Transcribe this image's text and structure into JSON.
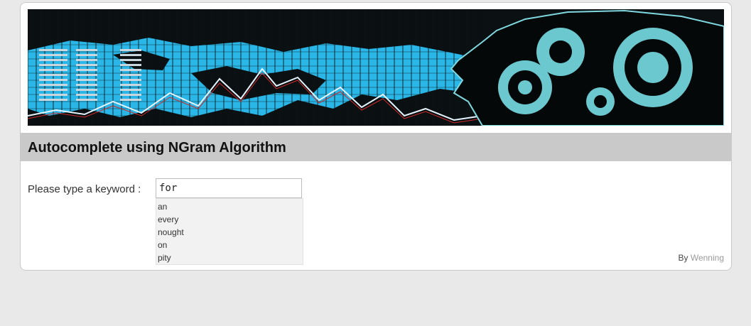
{
  "header": {
    "title": "Autocomplete using NGram Algorithm"
  },
  "banner": {
    "icon": "brain-gears-world-map-banner"
  },
  "form": {
    "label": "Please type a keyword :",
    "input_value": "for"
  },
  "suggestions": [
    "an",
    "every",
    "nought",
    "on",
    "pity"
  ],
  "footer": {
    "by_label": "By",
    "author": "Wenning"
  },
  "colors": {
    "page_bg": "#e9e9e9",
    "titlebar_bg": "#c9c9c9",
    "banner_cyan": "#2ab6e6",
    "suggest_bg": "#f2f2f2",
    "author_link": "#9a9a9a"
  }
}
